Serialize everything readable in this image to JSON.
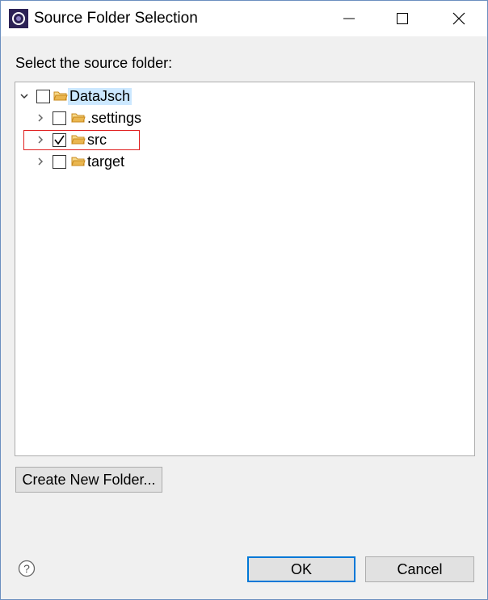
{
  "window": {
    "title": "Source Folder Selection"
  },
  "prompt": "Select the source folder:",
  "tree": {
    "items": [
      {
        "label": "DataJsch",
        "checked": false,
        "expanded": true,
        "selected": true
      },
      {
        "label": ".settings",
        "checked": false,
        "expanded": false
      },
      {
        "label": "src",
        "checked": true,
        "expanded": false,
        "highlighted": true
      },
      {
        "label": "target",
        "checked": false,
        "expanded": false
      }
    ]
  },
  "buttons": {
    "create_new_folder": "Create New Folder...",
    "ok": "OK",
    "cancel": "Cancel"
  },
  "colors": {
    "accent": "#0078d7",
    "highlight_border": "#e02020",
    "selection_bg": "#cce8ff",
    "folder": "#e8a33a"
  }
}
